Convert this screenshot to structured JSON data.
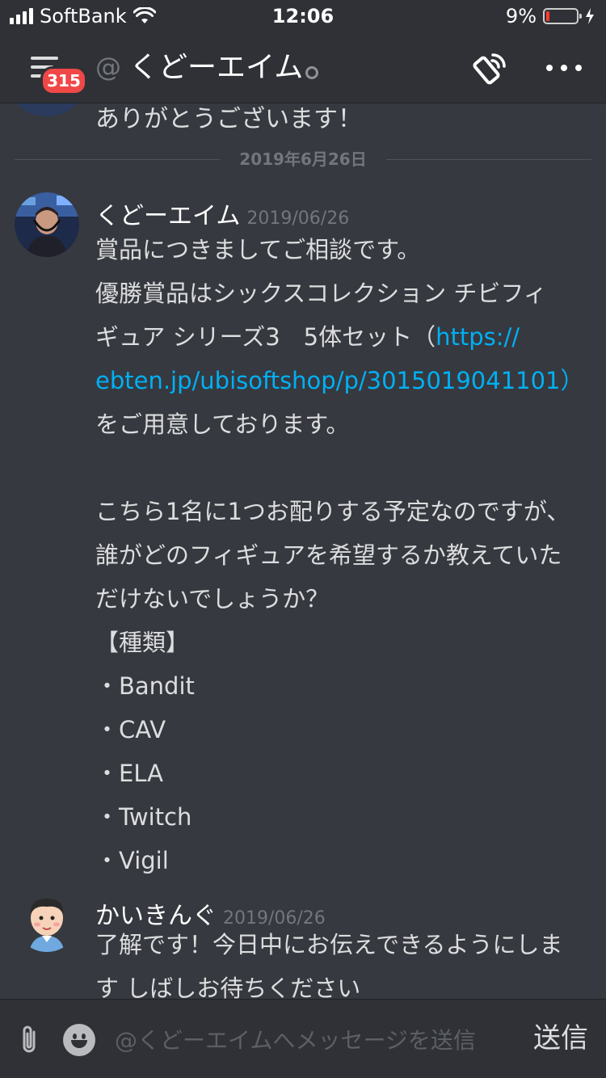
{
  "status_bar": {
    "carrier": "SoftBank",
    "time": "12:06",
    "battery_percent": "9%",
    "battery_level": 0.09,
    "battery_color": "#ff3b30"
  },
  "header": {
    "unread_badge": "315",
    "at_symbol": "@",
    "channel_title": "くどーエイム",
    "status": "offline",
    "call_icon": "phone-call-icon",
    "more_icon": "ellipsis-icon"
  },
  "chat": {
    "previous_message_partial": "ありがとうございます！",
    "date_divider": "2019年6月26日",
    "messages": [
      {
        "author": "くどーエイム",
        "timestamp": "2019/06/26",
        "lines": [
          "賞品につきましてご相談です。",
          "優勝賞品はシックスコレクション チビフィ",
          "ギュア シリーズ3　5体セット（",
          "https://",
          "ebten.jp/ubisoftshop/p/3015019041101",
          "）",
          "をご用意しております。",
          "",
          "こちら1名に1つお配りする予定なのですが、",
          "誰がどのフィギュアを希望するか教えていた",
          "だけないでしょうか？",
          "【種類】",
          "・Bandit",
          "・CAV",
          "・ELA",
          "・Twitch",
          "・Vigil"
        ]
      },
      {
        "author": "かいきんぐ",
        "timestamp": "2019/06/26",
        "lines": [
          "了解です！今日中にお伝えできるようにしま",
          "す しばしお待ちください"
        ]
      }
    ]
  },
  "input_bar": {
    "placeholder": "@くどーエイムへメッセージを送信",
    "send_label": "送信",
    "attach_icon": "paperclip-icon",
    "emoji_icon": "emoji-icon"
  },
  "colors": {
    "background": "#36393f",
    "header": "#2f3136",
    "link": "#00b0f4",
    "badge": "#f04747"
  }
}
